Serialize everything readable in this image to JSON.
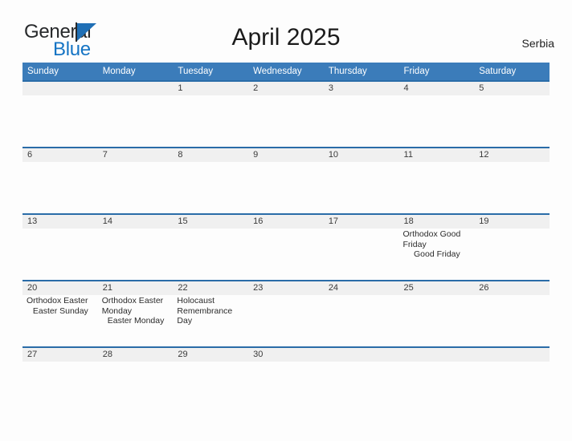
{
  "brand": {
    "name_part1": "General",
    "name_part2": "Blue",
    "flag_icon": "flag-triangle-icon"
  },
  "header": {
    "title": "April 2025",
    "country": "Serbia"
  },
  "colors": {
    "header_blue": "#3b7cba",
    "row_border_blue": "#2a6ca8",
    "daynum_band": "#f0f0f0",
    "brand_blue": "#1574c4",
    "page_background": "#fdfdfd"
  },
  "weekday_headers": [
    "Sunday",
    "Monday",
    "Tuesday",
    "Wednesday",
    "Thursday",
    "Friday",
    "Saturday"
  ],
  "weeks": [
    {
      "days": [
        {
          "number": "",
          "events": []
        },
        {
          "number": "",
          "events": []
        },
        {
          "number": "1",
          "events": []
        },
        {
          "number": "2",
          "events": []
        },
        {
          "number": "3",
          "events": []
        },
        {
          "number": "4",
          "events": []
        },
        {
          "number": "5",
          "events": []
        }
      ]
    },
    {
      "days": [
        {
          "number": "6",
          "events": []
        },
        {
          "number": "7",
          "events": []
        },
        {
          "number": "8",
          "events": []
        },
        {
          "number": "9",
          "events": []
        },
        {
          "number": "10",
          "events": []
        },
        {
          "number": "11",
          "events": []
        },
        {
          "number": "12",
          "events": []
        }
      ]
    },
    {
      "days": [
        {
          "number": "13",
          "events": []
        },
        {
          "number": "14",
          "events": []
        },
        {
          "number": "15",
          "events": []
        },
        {
          "number": "16",
          "events": []
        },
        {
          "number": "17",
          "events": []
        },
        {
          "number": "18",
          "events": [
            {
              "text": "Orthodox Good Friday",
              "align": "left"
            },
            {
              "text": "Good Friday",
              "align": "center"
            }
          ]
        },
        {
          "number": "19",
          "events": []
        }
      ]
    },
    {
      "days": [
        {
          "number": "20",
          "events": [
            {
              "text": "Orthodox Easter",
              "align": "left"
            },
            {
              "text": "Easter Sunday",
              "align": "center"
            }
          ]
        },
        {
          "number": "21",
          "events": [
            {
              "text": "Orthodox Easter Monday",
              "align": "left"
            },
            {
              "text": "Easter Monday",
              "align": "center"
            }
          ]
        },
        {
          "number": "22",
          "events": [
            {
              "text": "Holocaust Remembrance Day",
              "align": "left"
            }
          ]
        },
        {
          "number": "23",
          "events": []
        },
        {
          "number": "24",
          "events": []
        },
        {
          "number": "25",
          "events": []
        },
        {
          "number": "26",
          "events": []
        }
      ]
    },
    {
      "days": [
        {
          "number": "27",
          "events": []
        },
        {
          "number": "28",
          "events": []
        },
        {
          "number": "29",
          "events": []
        },
        {
          "number": "30",
          "events": []
        },
        {
          "number": "",
          "events": []
        },
        {
          "number": "",
          "events": []
        },
        {
          "number": "",
          "events": []
        }
      ]
    }
  ]
}
